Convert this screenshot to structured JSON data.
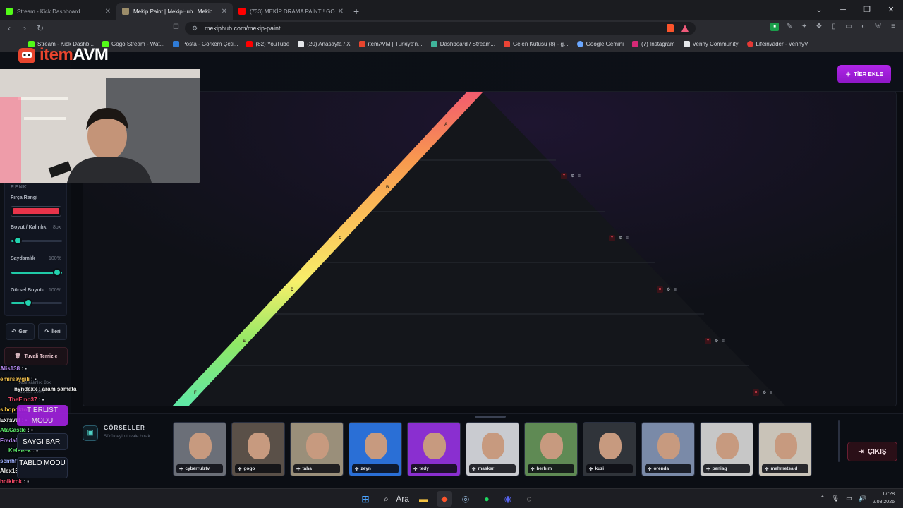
{
  "browser": {
    "tabs": [
      {
        "title": "Stream - Kick Dashboard",
        "color": "#53fc18",
        "active": false
      },
      {
        "title": "Mekip Paint | MekipHub | Mekip",
        "color": "#9c8d6a",
        "active": true
      },
      {
        "title": "(733) MEKİP DRAMA PAİNTİ! GOGO",
        "color": "#ff0000",
        "active": false
      }
    ],
    "url": "mekiphub.com/mekip-paint",
    "bookmarks": [
      {
        "label": "Stream - Kick Dashb...",
        "color": "#53fc18"
      },
      {
        "label": "Gogo Stream - Wat...",
        "color": "#53fc18"
      },
      {
        "label": "Posta - Görkem Çeti...",
        "color": "#2f7bd6"
      },
      {
        "label": "(82) YouTube",
        "color": "#ff0000"
      },
      {
        "label": "(20) Anasayfa / X",
        "color": "#e5e7eb"
      },
      {
        "label": "itemAVM | Türkiye'n...",
        "color": "#e8452e"
      },
      {
        "label": "Dashboard / Stream...",
        "color": "#3fb39a"
      },
      {
        "label": "Gelen Kutusu (8) - g...",
        "color": "#ea4335"
      },
      {
        "label": "Google Gemini",
        "color": "#6aa7ff"
      },
      {
        "label": "(7) Instagram",
        "color": "#d62976"
      },
      {
        "label": "Venny Community",
        "color": "#e5e7eb"
      },
      {
        "label": "Lifeinvader - VennyV",
        "color": "#e53935"
      }
    ]
  },
  "overlay": {
    "logo_prefix": "item",
    "logo_suffix": "AVM"
  },
  "toolbar": {
    "tier_add_label": "TİER EKLE"
  },
  "sidebar": {
    "section_label": "RENK",
    "brush_color_label": "Fırça Rengi",
    "brush_color": "#e8344a",
    "size_label": "Boyut / Kalınlık",
    "size_value": "8px",
    "size_fraction": 0.12,
    "opacity_label": "Saydamlık",
    "opacity_value": "100%",
    "opacity_fraction": 1.0,
    "image_size_label": "Görsel Boyutu",
    "image_size_value": "100%",
    "image_size_fraction": 0.33,
    "undo_label": "Geri",
    "redo_label": "İleri",
    "clear_label": "Tuvali Temizle",
    "active_size_label": "Aktif kalınlık: 8px",
    "image_pct_label": "Görsel: 100%"
  },
  "pyramid": {
    "tiers": [
      {
        "label": "A",
        "color": "#f25c6e"
      },
      {
        "label": "B",
        "color": "#f89a4e"
      },
      {
        "label": "C",
        "color": "#fbc45a"
      },
      {
        "label": "D",
        "color": "#f7ef6a"
      },
      {
        "label": "E",
        "color": "#8fe866"
      },
      {
        "label": "F",
        "color": "#5ee8a8"
      }
    ]
  },
  "chat": [
    {
      "user": "Alis138",
      "msg": "",
      "color": "#b98cf5"
    },
    {
      "user": "emirsaygili",
      "msg": "",
      "color": "#f2c14e"
    },
    {
      "user": "nyndexx",
      "msg": "aram şamata",
      "color": "#f2f2f2"
    },
    {
      "user": "TheEmo37",
      "msg": "",
      "color": "#ff4d6d"
    },
    {
      "user": "sibopoktor",
      "msg": "",
      "color": "#f5c542"
    },
    {
      "user": "Exravel",
      "msg": "",
      "color": "#f2f2f2"
    },
    {
      "user": "AtaCastle",
      "msg": "",
      "color": "#5ee86a"
    },
    {
      "user": "Freda1813",
      "msg": "",
      "color": "#b98cf5"
    },
    {
      "user": "KelPeEk",
      "msg": "",
      "color": "#5ee86a"
    },
    {
      "user": "semhfkinTANK",
      "msg": "",
      "color": "#9fb0ff"
    },
    {
      "user": "Alex158",
      "msg": "",
      "color": "#f2f2f2"
    },
    {
      "user": "hoikirok",
      "msg": "",
      "color": "#ff4d6d"
    }
  ],
  "modes": {
    "tierlist_label": "TİERLİST MODU",
    "color_bar_label": "SAYGI BARI",
    "table_label": "TABLO MODU"
  },
  "images": {
    "title": "GÖRSELLER",
    "subtitle": "Sürükleyip tuvale bırak.",
    "items": [
      {
        "name": "cyberrulztv",
        "bg": "#6b6f78"
      },
      {
        "name": "gogo",
        "bg": "#5a5048"
      },
      {
        "name": "taha",
        "bg": "#9a8f7a"
      },
      {
        "name": "zeyn",
        "bg": "#2a6fd6"
      },
      {
        "name": "tedy",
        "bg": "#8a2fd0"
      },
      {
        "name": "maskar",
        "bg": "#c9cbd0"
      },
      {
        "name": "berhim",
        "bg": "#5f8a54"
      },
      {
        "name": "kuzi",
        "bg": "#30343a"
      },
      {
        "name": "orenda",
        "bg": "#7a8aa8"
      },
      {
        "name": "peniag",
        "bg": "#c7c7c7"
      },
      {
        "name": "mehmetsaid",
        "bg": "#c9c3b8"
      }
    ]
  },
  "exit_label": "ÇIKIŞ",
  "taskbar": {
    "search_label": "Ara",
    "time": "17:28",
    "date": "2.08.2026"
  }
}
